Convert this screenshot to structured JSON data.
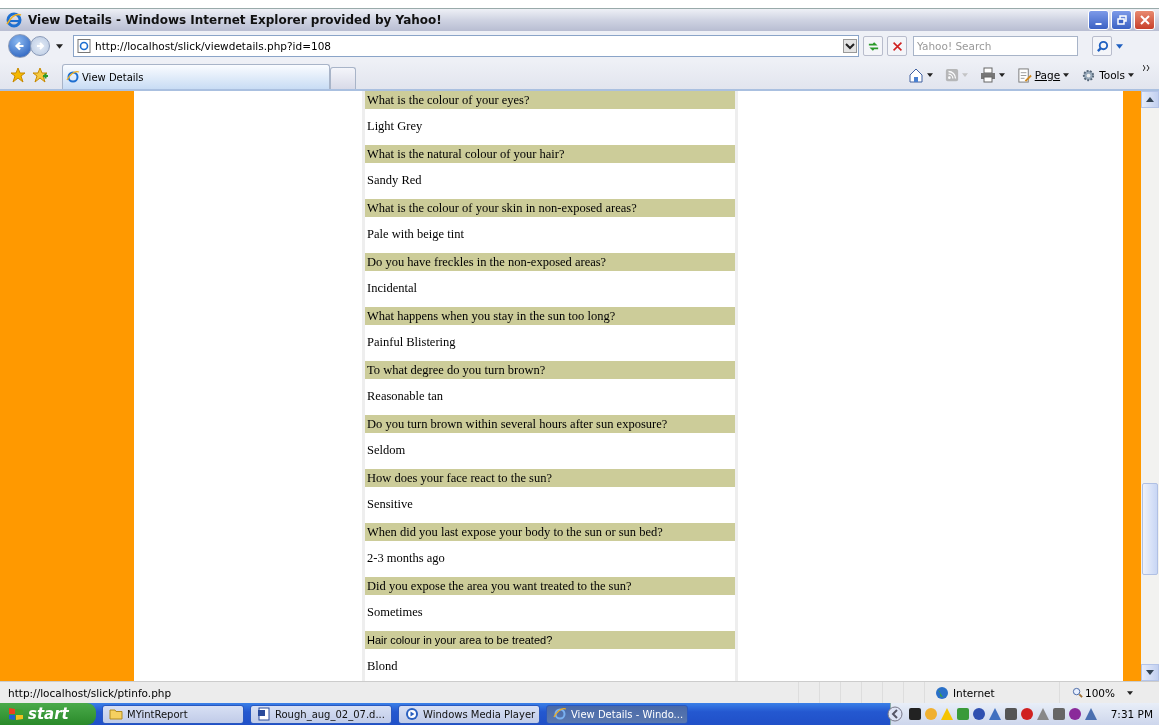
{
  "window": {
    "title": "View Details - Windows Internet Explorer provided by Yahoo!"
  },
  "address_bar": {
    "url": "http://localhost/slick/viewdetails.php?id=108"
  },
  "search": {
    "placeholder": "Yahoo! Search"
  },
  "tabs": [
    {
      "label": "View Details",
      "selected": true
    }
  ],
  "command_bar": [
    {
      "kind": "home"
    },
    {
      "kind": "feeds",
      "disabled": true
    },
    {
      "kind": "print"
    },
    {
      "kind": "page",
      "label": "Page"
    },
    {
      "kind": "tools",
      "label": "Tools"
    }
  ],
  "details": [
    {
      "question": "What is the colour of your eyes?",
      "answer": "Light Grey",
      "kind": "serif"
    },
    {
      "question": "What is the natural colour of your hair?",
      "answer": "Sandy Red",
      "kind": "serif"
    },
    {
      "question": "What is the colour of your skin in non-exposed areas?",
      "answer": "Pale with beige tint",
      "kind": "serif"
    },
    {
      "question": "Do you have freckles in the non-exposed areas?",
      "answer": "Incidental",
      "kind": "serif"
    },
    {
      "question": "What happens when you stay in the sun too long?",
      "answer": "Painful Blistering",
      "kind": "serif"
    },
    {
      "question": "To what degree do you turn brown?",
      "answer": "Reasonable tan",
      "kind": "serif"
    },
    {
      "question": "Do you turn brown within several hours after sun exposure?",
      "answer": "Seldom",
      "kind": "serif"
    },
    {
      "question": "How does your face react to the sun?",
      "answer": "Sensitive",
      "kind": "serif"
    },
    {
      "question": "When did you last expose your body to the sun or sun bed?",
      "answer": "2-3 months ago",
      "kind": "serif"
    },
    {
      "question": "Did you expose the area you want treated to the sun?",
      "answer": "Sometimes",
      "kind": "serif"
    },
    {
      "question": "Hair colour in your area to be treated?",
      "answer": "Blond",
      "kind": "sans"
    }
  ],
  "status_bar": {
    "text": "http://localhost/slick/ptinfo.php",
    "zone": "Internet",
    "zoom": "100%"
  },
  "taskbar": {
    "start": "start",
    "buttons": [
      {
        "label": "MYintReport",
        "kind": "folder",
        "selected": false
      },
      {
        "label": "Rough_aug_02_07.d...",
        "kind": "word",
        "selected": false
      },
      {
        "label": "Windows Media Player",
        "kind": "media",
        "selected": false
      },
      {
        "label": "View Details - Windo...",
        "kind": "ie",
        "selected": true
      }
    ],
    "clock": "7:31 PM"
  }
}
